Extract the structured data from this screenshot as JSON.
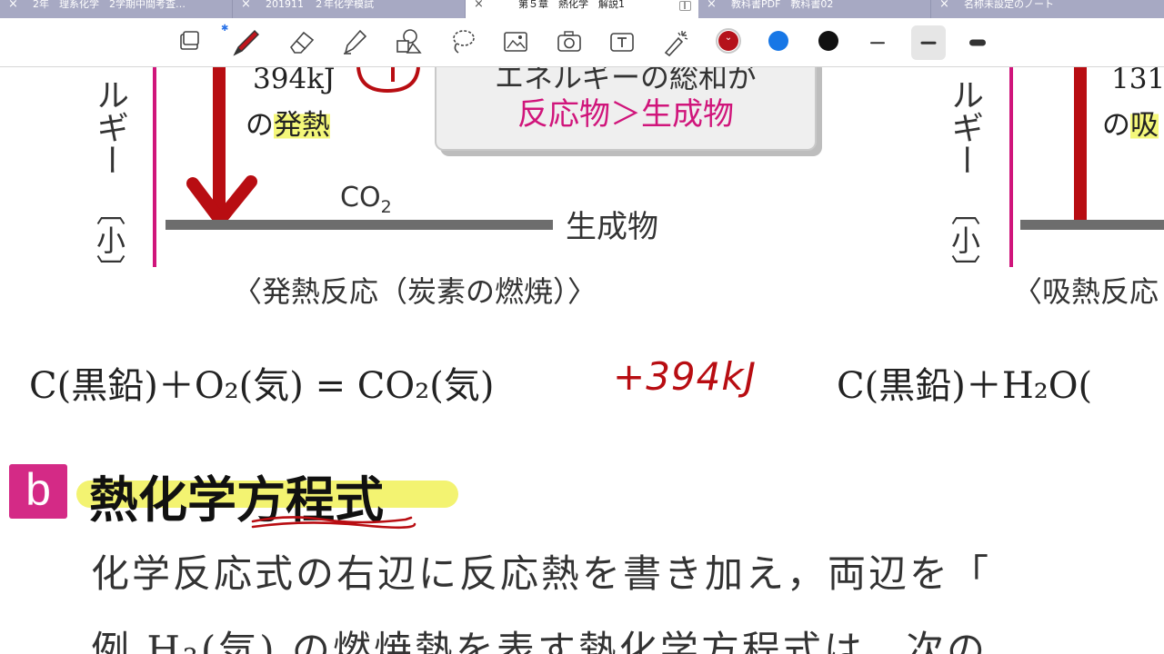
{
  "tabs": [
    {
      "label": "2年　理系化学　2学期中間考査…",
      "active": false
    },
    {
      "label": "201911　２年化学模試",
      "active": false
    },
    {
      "label": "第５章　熱化学　解説1",
      "active": true
    },
    {
      "label": "教科書PDF　教科書02",
      "active": false
    },
    {
      "label": "名称未設定のノート",
      "active": false
    }
  ],
  "tab_close_glyph": "×",
  "toolbar": {
    "tools": [
      "page-icon",
      "pen-icon",
      "eraser-icon",
      "highlighter-icon",
      "shapes-icon",
      "lasso-icon",
      "image-icon",
      "camera-icon",
      "text-icon",
      "laser-pointer-icon"
    ],
    "colors": {
      "red": "#b5121b",
      "blue": "#1777e6",
      "black": "#111111"
    },
    "selected_color": "red",
    "bluetooth_glyph": "✱",
    "color_chevron": "⌄"
  },
  "diagram_left": {
    "energy_value": "394kJ",
    "heat_prefix": "の",
    "heat_word": "発熱",
    "vertical_label": "ルギー",
    "small_label": "〔小〕",
    "product_formula": "CO",
    "product_subscript": "2",
    "product_label": "生成物",
    "caption": "〈発熱反応（炭素の燃焼）〉"
  },
  "callout": {
    "line1": "エネルギーの総和が",
    "line2": "反応物＞生成物"
  },
  "diagram_right": {
    "energy_value": "131",
    "heat_prefix": "の",
    "heat_word": "吸",
    "vertical_label": "ルギー",
    "small_label": "〔小〕",
    "caption": "〈吸熱反応"
  },
  "equation_left": {
    "text": "C(黒鉛)＋O₂(気) = CO₂(気)",
    "handwritten": "+394kJ"
  },
  "equation_right": {
    "text": "C(黒鉛)＋H₂O("
  },
  "section": {
    "badge": "b",
    "title": "熱化学方程式"
  },
  "body_lines": [
    "化学反応式の右辺に反応熱を書き加え，両辺を「",
    "例 H₂(気) の燃焼熱を表す熱化学方程式は，次の"
  ]
}
